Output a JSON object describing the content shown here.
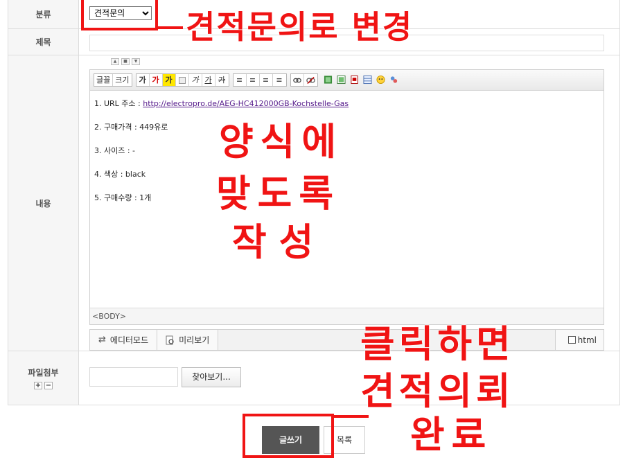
{
  "form": {
    "category": {
      "label": "분류",
      "selected": "견적문의"
    },
    "title": {
      "label": "제목",
      "value": ""
    },
    "content": {
      "label": "내용"
    },
    "file": {
      "label": "파일첨부",
      "add": "+",
      "remove": "−",
      "browse": "찾아보기..."
    }
  },
  "editor": {
    "toolbar": {
      "font_label": "글꼴",
      "size_label": "크기",
      "text_buttons": [
        "가",
        "가",
        "가",
        "가",
        "가",
        "가"
      ],
      "super_label": "가"
    },
    "body": {
      "line1_prefix": "1. URL 주소 : ",
      "line1_link": "http://electropro.de/AEG-HC412000GB-Kochstelle-Gas",
      "line2": "2. 구매가격 : 449유로",
      "line3": "3. 사이즈 : -",
      "line4": "4. 색상 : black",
      "line5": "5. 구매수량 : 1개"
    },
    "tag_path": "<BODY>",
    "mode_editor": "에디터모드",
    "mode_preview": "미리보기",
    "html_label": "html"
  },
  "actions": {
    "submit": "글쓰기",
    "list": "목록"
  },
  "annotations": {
    "change": "견적문의로 변경",
    "format_1": "양식에",
    "format_2": "맞도록",
    "format_3": "작성",
    "click_1": "클릭하면",
    "click_2": "견적의뢰",
    "click_3": "완료"
  },
  "colors": {
    "annotation": "#f01414",
    "submit_bg": "#555555",
    "link": "#551a8b"
  }
}
